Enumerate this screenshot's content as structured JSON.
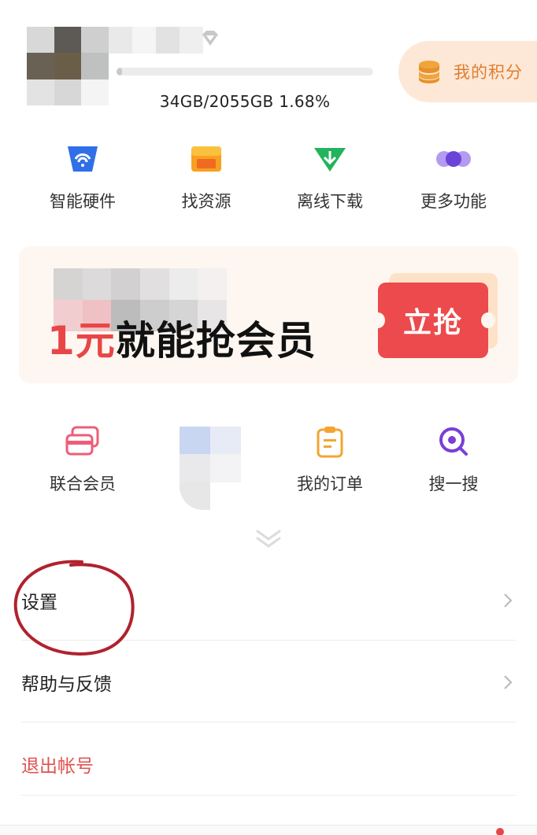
{
  "header": {
    "storage_text": "34GB/2055GB   1.68%",
    "storage_used_fraction": 0.0168,
    "points_label": "我的积分"
  },
  "colors": {
    "accent_orange": "#e07d2c",
    "points_bg": "#fde8d8",
    "banner_red": "#e84646",
    "ticket_red": "#ec4a4c",
    "logout_red": "#e0524e"
  },
  "features_row1": [
    {
      "label": "智能硬件",
      "icon": "smart-hardware-icon"
    },
    {
      "label": "找资源",
      "icon": "resource-box-icon"
    },
    {
      "label": "离线下载",
      "icon": "offline-download-icon"
    },
    {
      "label": "更多功能",
      "icon": "more-functions-icon"
    }
  ],
  "banner": {
    "price": "1元",
    "title_rest": "就能抢会员",
    "button_label": "立抢"
  },
  "features_row2": [
    {
      "label": "联合会员",
      "icon": "joint-membership-card-icon"
    },
    {
      "label": "我的订单",
      "icon": "order-clipboard-icon"
    },
    {
      "label": "搜一搜",
      "icon": "search-magnifier-icon"
    }
  ],
  "menu": {
    "settings": "设置",
    "help": "帮助与反馈",
    "logout": "退出帐号"
  }
}
